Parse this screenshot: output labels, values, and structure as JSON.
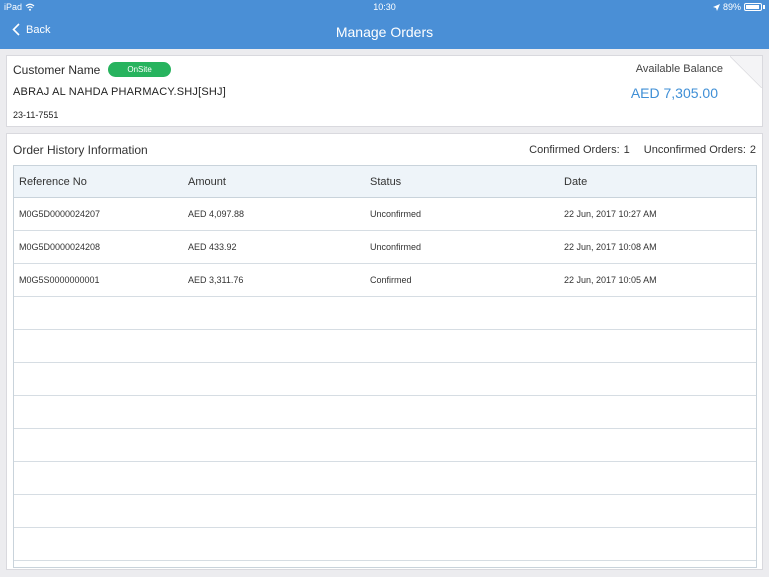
{
  "statusbar": {
    "device": "iPad",
    "time": "10:30",
    "battery": "89%"
  },
  "navbar": {
    "back_label": "Back",
    "title": "Manage Orders"
  },
  "customer": {
    "label": "Customer Name",
    "badge": "OnSite",
    "name": "ABRAJ AL NAHDA PHARMACY.SHJ[SHJ]",
    "id": "23-11-7551",
    "balance_label": "Available Balance",
    "balance_value": "AED 7,305.00"
  },
  "history": {
    "title": "Order History Information",
    "confirmed_label": "Confirmed Orders:",
    "confirmed_count": "1",
    "unconfirmed_label": "Unconfirmed Orders:",
    "unconfirmed_count": "2",
    "columns": [
      "Reference No",
      "Amount",
      "Status",
      "Date"
    ],
    "rows": [
      {
        "ref": "M0G5D0000024207",
        "amount": "AED 4,097.88",
        "status": "Unconfirmed",
        "date": "22 Jun, 2017 10:27 AM"
      },
      {
        "ref": "M0G5D0000024208",
        "amount": "AED 433.92",
        "status": "Unconfirmed",
        "date": "22 Jun, 2017 10:08 AM"
      },
      {
        "ref": "M0G5S0000000001",
        "amount": "AED 3,311.76",
        "status": "Confirmed",
        "date": "22 Jun, 2017 10:05 AM"
      }
    ]
  },
  "colors": {
    "header": "#4a8fd6",
    "badge": "#27b35e",
    "balance": "#3f8fd6"
  }
}
